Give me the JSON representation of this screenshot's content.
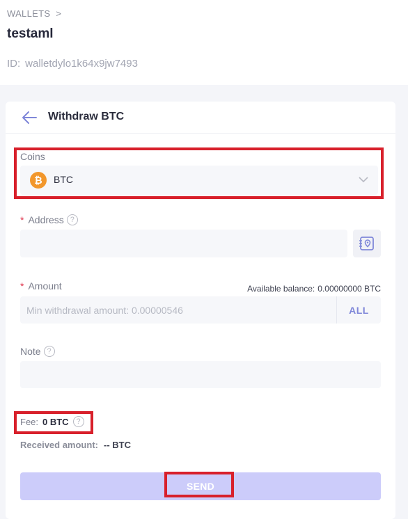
{
  "breadcrumb": {
    "root": "WALLETS",
    "separator": ">"
  },
  "wallet": {
    "name": "testaml",
    "id_label": "ID:",
    "id_value": "walletdylo1k64x9jw7493"
  },
  "card": {
    "title": "Withdraw BTC",
    "back_icon": "arrow-left-icon"
  },
  "coins": {
    "label": "Coins",
    "selected": "BTC",
    "coin_icon_glyph": "₿",
    "chevron_icon": "chevron-down-icon"
  },
  "address": {
    "label": "Address",
    "required_mark": "*",
    "value": "",
    "placeholder": "",
    "address_book_icon": "address-book-pin-icon"
  },
  "amount": {
    "label": "Amount",
    "required_mark": "*",
    "available_label": "Available balance:",
    "available_value": "0.00000000 BTC",
    "placeholder": "Min withdrawal amount: 0.00000546",
    "all_label": "ALL"
  },
  "note": {
    "label": "Note",
    "value": ""
  },
  "fee": {
    "label": "Fee:",
    "value": "0 BTC"
  },
  "received": {
    "label": "Received amount:",
    "value": "-- BTC"
  },
  "send": {
    "label": "SEND"
  },
  "help_glyph": "?",
  "colors": {
    "accent": "#7f87d9",
    "send_disabled": "#ccccfa",
    "highlight": "#d8202b",
    "required": "#e0364e",
    "btc": "#f2972c"
  }
}
